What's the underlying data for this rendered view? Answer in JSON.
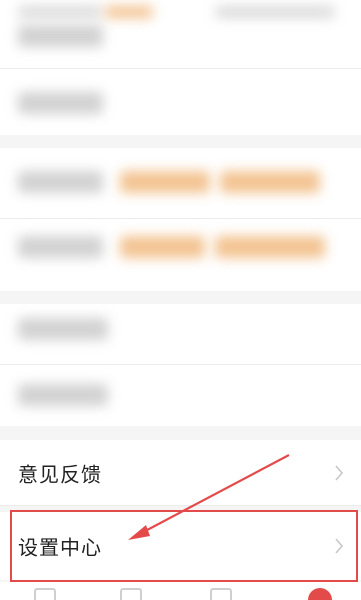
{
  "settings_list": {
    "feedback_label": "意见反馈",
    "settings_center_label": "设置中心"
  },
  "colors": {
    "highlight": "#e34b4b",
    "arrow": "#e34b4b"
  }
}
